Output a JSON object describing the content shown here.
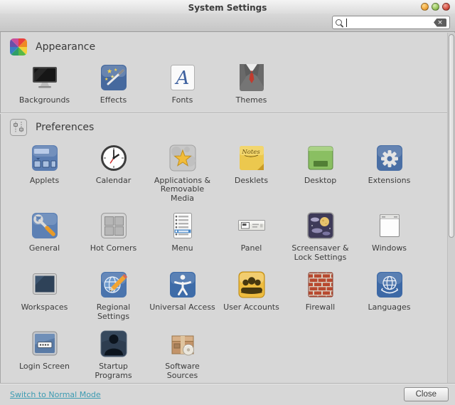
{
  "window": {
    "title": "System Settings",
    "controls": [
      {
        "name": "minimize-button",
        "icon": "minimize-orb-icon"
      },
      {
        "name": "maximize-button",
        "icon": "maximize-orb-icon"
      },
      {
        "name": "close-button",
        "icon": "close-orb-icon"
      }
    ]
  },
  "search": {
    "value": "",
    "placeholder": "",
    "icons": [
      "search-icon",
      "clear-icon"
    ]
  },
  "sections": [
    {
      "id": "appearance",
      "title": "Appearance",
      "icon": "color-wheel-icon",
      "items": [
        {
          "label": "Backgrounds",
          "icon": "monitor-icon"
        },
        {
          "label": "Effects",
          "icon": "magic-wand-icon"
        },
        {
          "label": "Fonts",
          "icon": "font-letter-icon"
        },
        {
          "label": "Themes",
          "icon": "suit-icon"
        }
      ]
    },
    {
      "id": "preferences",
      "title": "Preferences",
      "icon": "sliders-icon",
      "items": [
        {
          "label": "Applets",
          "icon": "applets-panel-icon"
        },
        {
          "label": "Calendar",
          "icon": "clock-icon"
        },
        {
          "label": "Applications &\nRemovable\nMedia",
          "icon": "star-icon"
        },
        {
          "label": "Desklets",
          "icon": "sticky-note-icon"
        },
        {
          "label": "Desktop",
          "icon": "desktop-icon"
        },
        {
          "label": "Extensions",
          "icon": "gear-icon"
        },
        {
          "label": "General",
          "icon": "tools-icon"
        },
        {
          "label": "Hot Corners",
          "icon": "hot-corners-icon"
        },
        {
          "label": "Menu",
          "icon": "menu-list-icon"
        },
        {
          "label": "Panel",
          "icon": "panel-icon"
        },
        {
          "label": "Screensaver &\nLock Settings",
          "icon": "night-sky-icon"
        },
        {
          "label": "Windows",
          "icon": "window-frame-icon"
        },
        {
          "label": "Workspaces",
          "icon": "workspaces-icon"
        },
        {
          "label": "Regional\nSettings",
          "icon": "globe-pencil-icon"
        },
        {
          "label": "Universal Access",
          "icon": "accessibility-icon"
        },
        {
          "label": "User Accounts",
          "icon": "user-group-icon"
        },
        {
          "label": "Firewall",
          "icon": "brick-wall-icon"
        },
        {
          "label": "Languages",
          "icon": "un-globe-icon"
        },
        {
          "label": "Login Screen",
          "icon": "login-screen-icon"
        },
        {
          "label": "Startup\nPrograms",
          "icon": "person-silhouette-icon"
        },
        {
          "label": "Software\nSources",
          "icon": "package-box-icon"
        }
      ]
    }
  ],
  "footer": {
    "mode_link": "Switch to Normal Mode",
    "close_label": "Close"
  },
  "colors": {
    "link": "#3d9bb2",
    "background": "#d7d7d7",
    "titlebar_top": "#f4f4f4"
  }
}
